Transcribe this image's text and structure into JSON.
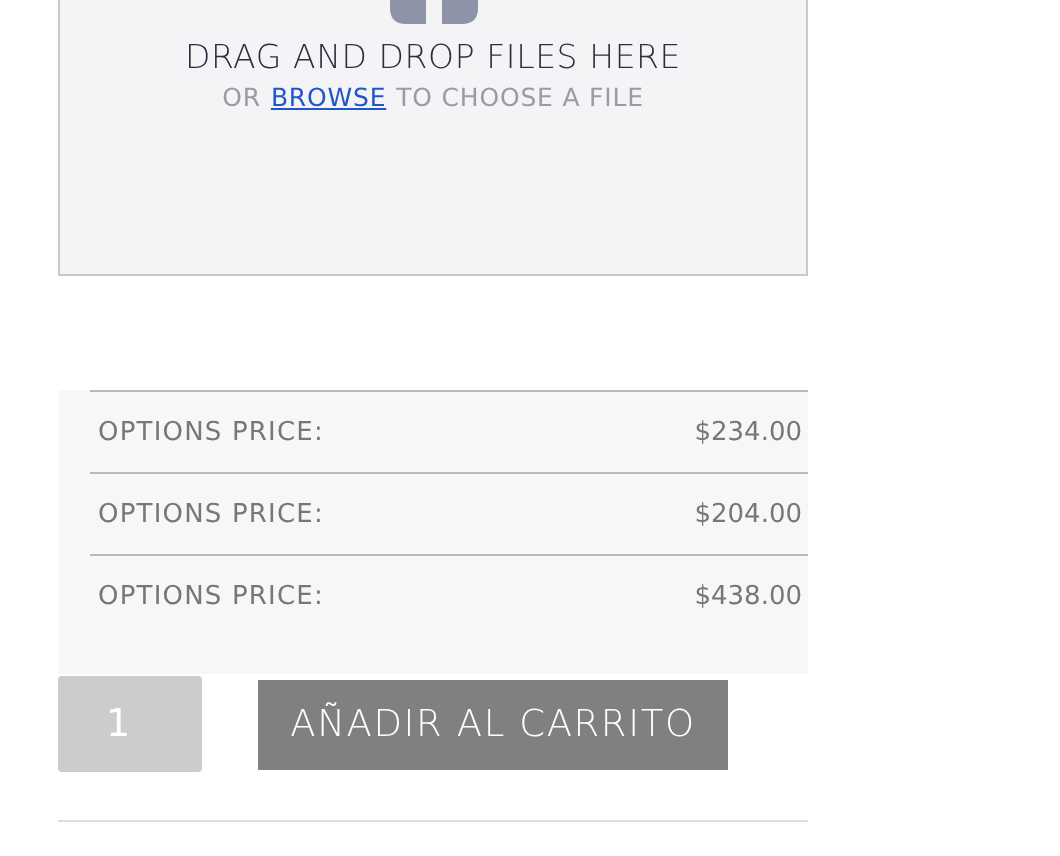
{
  "upload": {
    "title": "DRAG AND DROP FILES HERE",
    "prefix": "OR",
    "link": "BROWSE",
    "suffix": "TO CHOOSE A FILE"
  },
  "price_rows": [
    {
      "label": "OPTIONS PRICE:",
      "value": "$234.00"
    },
    {
      "label": "OPTIONS PRICE:",
      "value": "$204.00"
    },
    {
      "label": "OPTIONS PRICE:",
      "value": "$438.00"
    }
  ],
  "quantity": {
    "value": "1"
  },
  "add_to_cart": {
    "label": "AÑADIR AL CARRITO"
  }
}
